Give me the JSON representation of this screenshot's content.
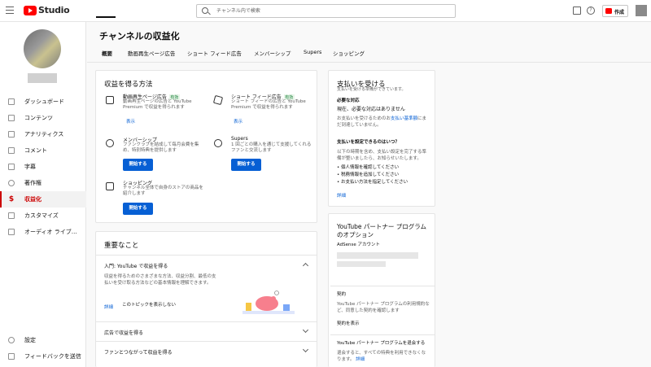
{
  "app": {
    "logo_text": "Studio"
  },
  "search": {
    "placeholder": "チャンネル内で検索"
  },
  "topbar": {
    "help_glyph": "?",
    "create_label": "作成"
  },
  "sidebar": {
    "items": [
      {
        "label": "ダッシュボード"
      },
      {
        "label": "コンテンツ"
      },
      {
        "label": "アナリティクス"
      },
      {
        "label": "コメント"
      },
      {
        "label": "字幕"
      },
      {
        "label": "著作権"
      },
      {
        "label": "収益化",
        "icon_glyph": "$",
        "active": true
      },
      {
        "label": "カスタマイズ"
      },
      {
        "label": "オーディオ ライブ…"
      }
    ],
    "bottom": [
      {
        "label": "設定"
      },
      {
        "label": "フィードバックを送信"
      }
    ]
  },
  "page": {
    "title": "チャンネルの収益化"
  },
  "tabs": [
    {
      "label": "概要",
      "active": true
    },
    {
      "label": "動画再生ページ広告"
    },
    {
      "label": "ショート フィード広告"
    },
    {
      "label": "メンバーシップ"
    },
    {
      "label": "Supers"
    },
    {
      "label": "ショッピング"
    }
  ],
  "ways": {
    "title": "収益を得る方法",
    "badge": "有効",
    "items": [
      {
        "title": "動画再生ページ広告",
        "desc1": "動画再生ページの広告と YouTube",
        "desc2": "Premium で収益を得られます",
        "action": "表示"
      },
      {
        "title": "ショート フィード広告",
        "desc1": "ショート フィードの広告と YouTube",
        "desc2": "Premium で収益を得られます",
        "action": "表示"
      },
      {
        "title": "メンバーシップ",
        "desc1": "ファンクラブを結成して毎月会費を集",
        "desc2": "め、特別特典を提供します",
        "action": "開始する"
      },
      {
        "title": "Supers",
        "desc1": "1 回ごとの購入を通じて支援してくれる",
        "desc2": "ファンと交流します",
        "action": "開始する"
      },
      {
        "title": "ショッピング",
        "desc1": "チャンネル全体で自身のストアの商品を",
        "desc2": "紹介します",
        "action": "開始する"
      }
    ]
  },
  "important": {
    "title": "重要なこと",
    "expanded_title": "入門: YouTube で収益を得る",
    "expanded_desc1": "収益を得るためのさまざまな方法、収益分割、最低の支",
    "expanded_desc2": "払いを受け取る方法などの基本情報を理解できます。",
    "details_link": "詳細",
    "hide_label": "このトピックを表示しない",
    "rows": [
      {
        "label": "広告で収益を得る"
      },
      {
        "label": "ファンとつながって収益を得る"
      }
    ]
  },
  "payments": {
    "title": "支払いを受ける",
    "subtitle": "支払いを受ける準備ができています。",
    "required_label": "必要な対応",
    "required_value": "現在、必要な対応はありません",
    "threshold_pre": "お支払いを受けるためのお",
    "threshold_link": "支払い基準額",
    "threshold_post": "にま",
    "threshold_line2": "だ到達していません。",
    "faq_title": "支払いを設定できるのはいつ？",
    "faq_desc1": "以下の時期を含め、支払い設定を完了する準",
    "faq_desc2": "備が整いましたら、お知らせいたします。",
    "bullets": [
      "個人情報を確認してください",
      "税務情報を追加してください",
      "お支払い方法を指定してください"
    ],
    "details_link": "詳細"
  },
  "ypp": {
    "title1": "YouTube パートナー プログラム",
    "title2": "のオプション",
    "adsense_label": "AdSense アカウント",
    "contract_label": "契約",
    "contract_desc1": "YouTube パートナー プログラムの利用規約な",
    "contract_desc2": "ど、同意した契約を確認します",
    "contract_link": "契約を表示",
    "leave_label": "YouTube パートナー プログラムを退会する",
    "leave_desc": "退会すると、すべての特典を利用できなくな",
    "leave_desc2": "ります。",
    "leave_link": "詳細"
  }
}
